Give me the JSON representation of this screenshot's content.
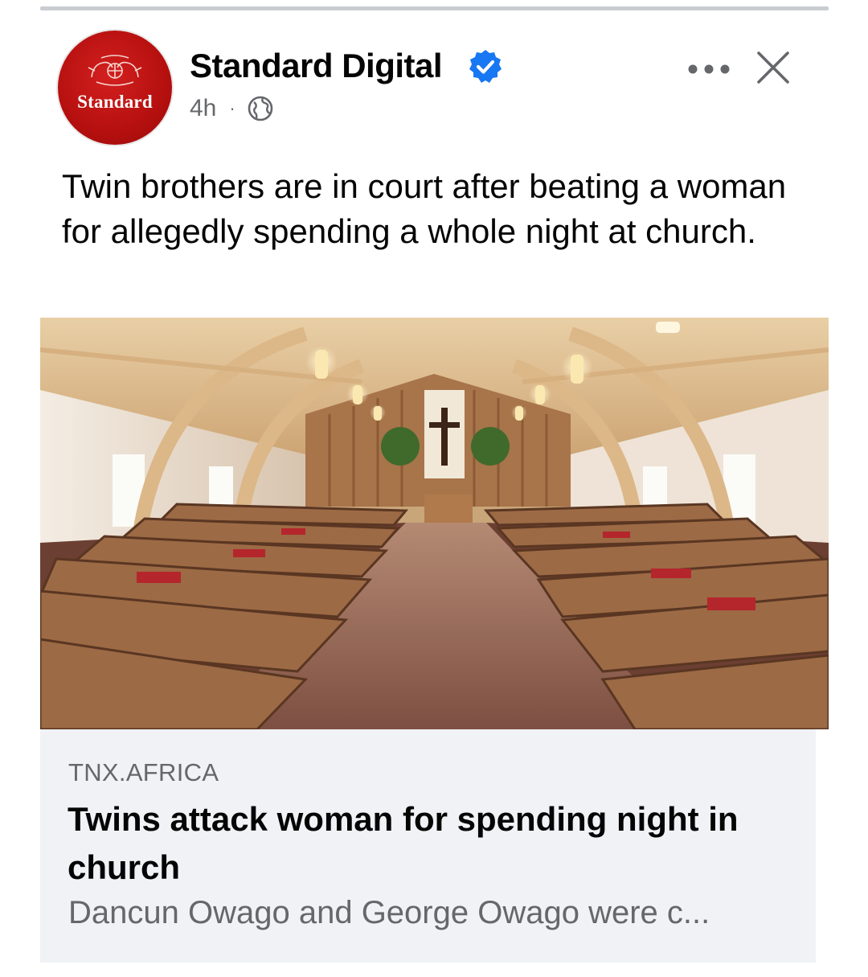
{
  "post": {
    "page_name": "Standard Digital",
    "avatar_text": "Standard",
    "time": "4h",
    "separator": "·",
    "audience_icon": "globe-icon",
    "verified_icon": "verified-badge-icon",
    "more_icon": "more-options-icon",
    "close_icon": "close-icon",
    "text": "Twin brothers are in court after beating a woman for allegedly spending a whole night at church."
  },
  "link_preview": {
    "domain": "TNX.AFRICA",
    "title": "Twins attack woman for spending night in church",
    "description": "Dancun Owago and George Owago were c..."
  },
  "colors": {
    "brand_red": "#c41514",
    "verified_blue": "#1877f2",
    "secondary_text": "#65676b",
    "card_bg": "#f0f2f5"
  }
}
